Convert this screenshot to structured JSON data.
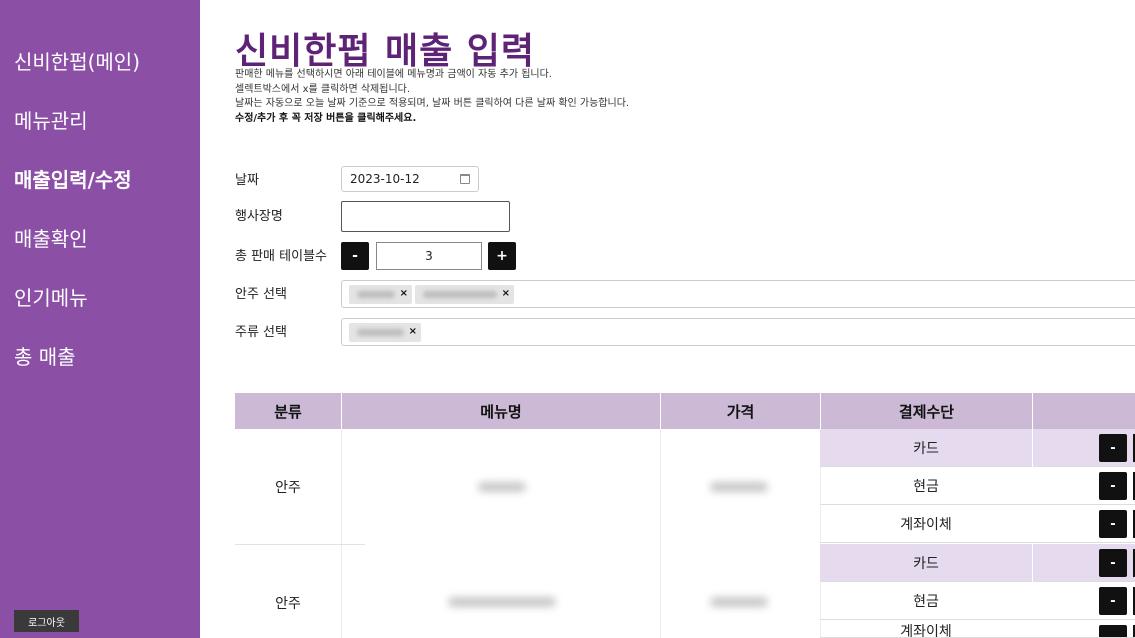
{
  "sidebar": {
    "items": [
      {
        "label": "신비한펍(메인)",
        "active": false
      },
      {
        "label": "메뉴관리",
        "active": false
      },
      {
        "label": "매출입력/수정",
        "active": true
      },
      {
        "label": "매출확인",
        "active": false
      },
      {
        "label": "인기메뉴",
        "active": false
      },
      {
        "label": "총 매출",
        "active": false
      }
    ],
    "logout_label": "로그아웃"
  },
  "page": {
    "title": "신비한펍 매출 입력",
    "notes": [
      "판매한 메뉴를 선택하시면 아래 테이블에 메뉴명과 금액이 자동 추가 됩니다.",
      "셀렉트박스에서 x를 클릭하면 삭제됩니다.",
      "날짜는 자동으로 오늘 날짜 기준으로 적용되며, 날짜 버튼 클릭하여 다른 날짜 확인 가능합니다.",
      "수정/추가 후 꼭 저장 버튼을 클릭해주세요."
    ]
  },
  "form": {
    "date_label": "날짜",
    "date_value": "2023-10-12",
    "event_label": "행사장명",
    "event_value": "",
    "tables_label": "총 판매 테이블수",
    "tables_value": "3",
    "minus_label": "-",
    "plus_label": "+",
    "snack_label": "안주 선택",
    "drink_label": "주류 선택",
    "chip_remove": "×"
  },
  "table": {
    "headers": [
      "분류",
      "메뉴명",
      "가격",
      "결제수단"
    ],
    "rows": [
      {
        "category": "안주",
        "payments": [
          "카드",
          "현금",
          "계좌이체"
        ]
      },
      {
        "category": "안주",
        "payments": [
          "카드",
          "현금",
          "계좌이체"
        ]
      }
    ],
    "row_minus": "-"
  },
  "colors": {
    "sidebar_bg": "#8b4fa6",
    "title": "#5e2276",
    "table_header": "#cbb9d6",
    "card_row": "#e6daee"
  }
}
